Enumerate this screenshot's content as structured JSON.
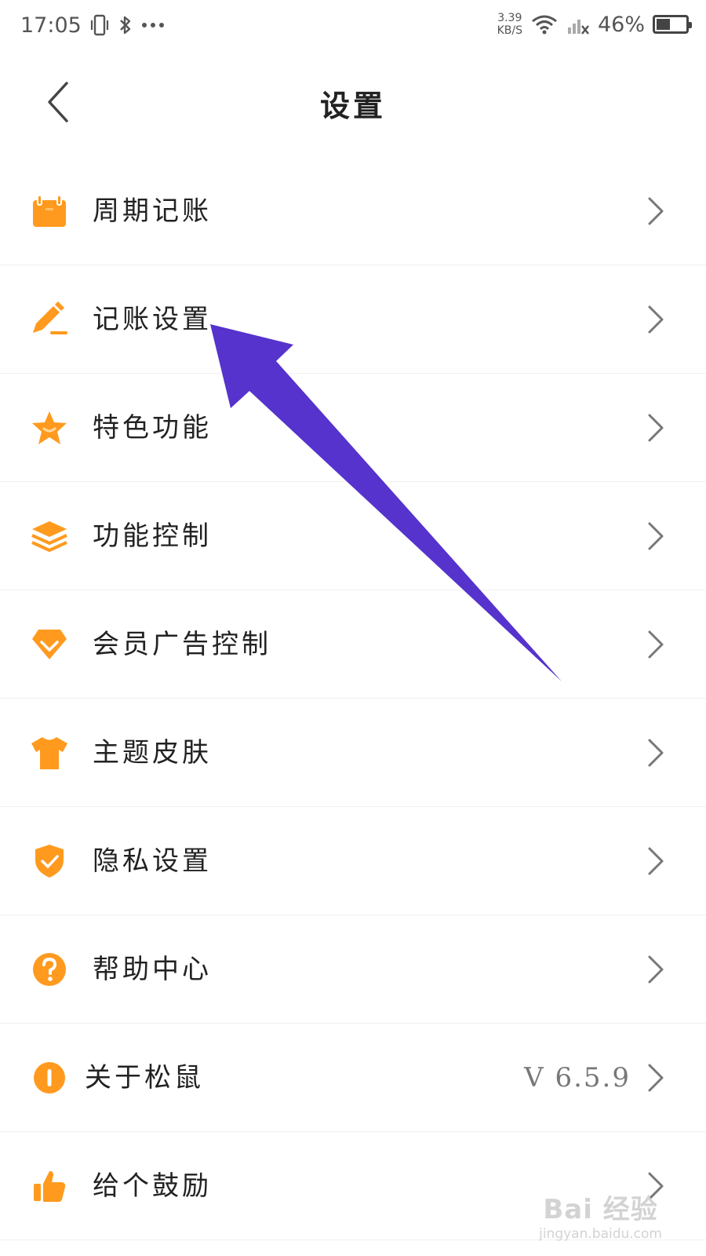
{
  "status_bar": {
    "time": "17:05",
    "net_speed_value": "3.39",
    "net_speed_unit": "KB/S",
    "battery_percent": "46%",
    "battery_level": 0.46
  },
  "nav": {
    "title": "设置"
  },
  "items": [
    {
      "label": "周期记账",
      "icon": "calendar-icon"
    },
    {
      "label": "记账设置",
      "icon": "pencil-icon"
    },
    {
      "label": "特色功能",
      "icon": "star-icon"
    },
    {
      "label": "功能控制",
      "icon": "layers-icon"
    },
    {
      "label": "会员广告控制",
      "icon": "gem-icon"
    },
    {
      "label": "主题皮肤",
      "icon": "tshirt-icon"
    },
    {
      "label": "隐私设置",
      "icon": "shield-check-icon"
    },
    {
      "label": "帮助中心",
      "icon": "question-icon"
    },
    {
      "label": "关于松鼠",
      "icon": "info-icon",
      "value": "V  6.5.9"
    },
    {
      "label": "给个鼓励",
      "icon": "thumbs-up-icon"
    }
  ],
  "watermark": {
    "main": "Bai 经验",
    "sub": "jingyan.baidu.com"
  },
  "colors": {
    "accent": "#FF9A1E",
    "annotation_arrow": "#5533CC",
    "chevron": "#777777"
  }
}
